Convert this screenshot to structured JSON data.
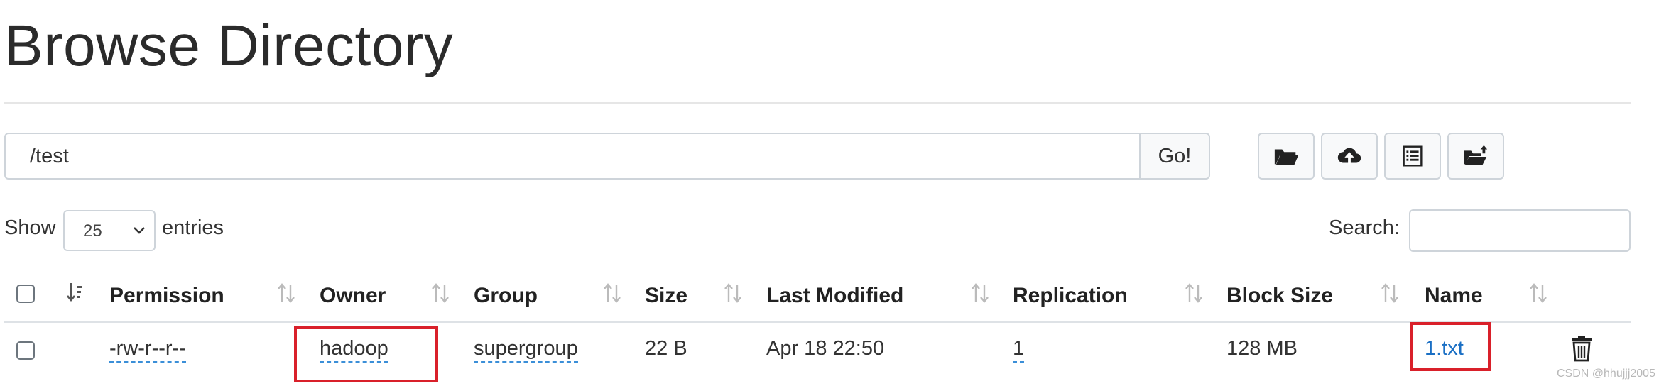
{
  "page": {
    "title": "Browse Directory"
  },
  "path_bar": {
    "value": "/test",
    "go_label": "Go!"
  },
  "toolbar": {
    "buttons": [
      {
        "icon": "folder-open-icon"
      },
      {
        "icon": "cloud-upload-icon"
      },
      {
        "icon": "list-icon"
      },
      {
        "icon": "folder-upload-icon"
      }
    ]
  },
  "controls": {
    "show_label": "Show",
    "entries_value": "25",
    "entries_label": "entries",
    "search_label": "Search:"
  },
  "table": {
    "columns": [
      "Permission",
      "Owner",
      "Group",
      "Size",
      "Last Modified",
      "Replication",
      "Block Size",
      "Name"
    ],
    "rows": [
      {
        "permission": "-rw-r--r--",
        "owner": "hadoop",
        "group": "supergroup",
        "size": "22 B",
        "last_modified": "Apr 18 22:50",
        "replication": "1",
        "block_size": "128 MB",
        "name": "1.txt"
      }
    ]
  },
  "watermark": "CSDN @hhujjj2005",
  "colors": {
    "accent_link": "#1a6fc4",
    "highlight": "#d9202a",
    "border": "#ced4da"
  }
}
